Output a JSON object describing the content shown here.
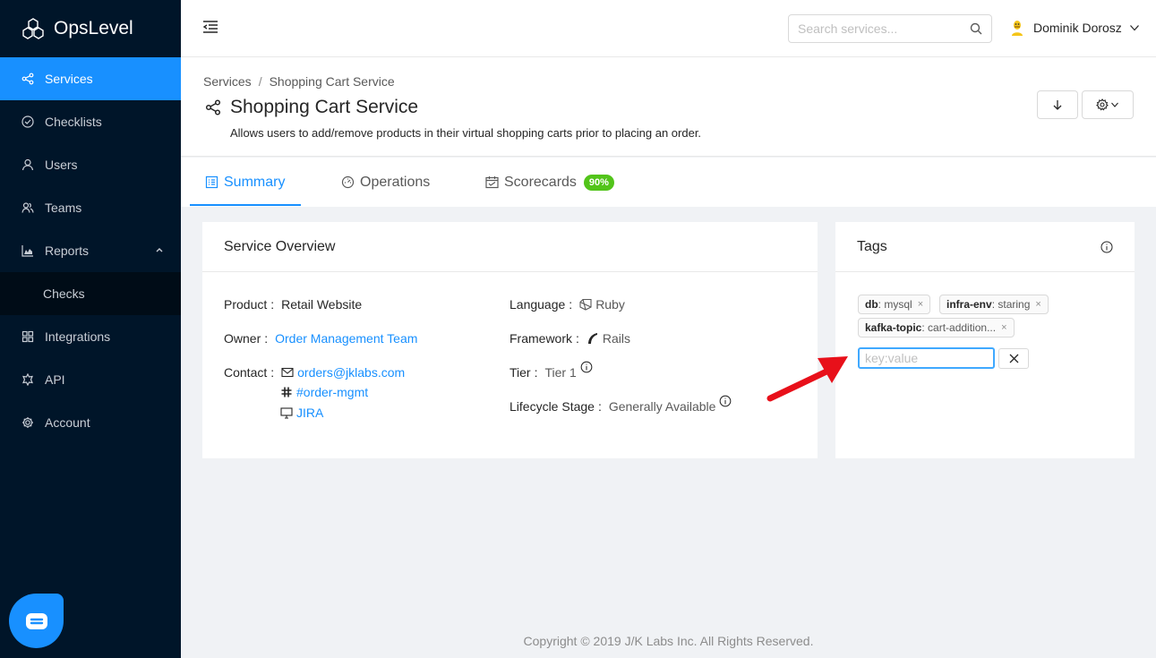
{
  "brand": {
    "name": "OpsLevel"
  },
  "sidebar": {
    "items": [
      {
        "label": "Services",
        "icon": "share-icon"
      },
      {
        "label": "Checklists",
        "icon": "check-circle-icon"
      },
      {
        "label": "Users",
        "icon": "user-icon"
      },
      {
        "label": "Teams",
        "icon": "team-icon"
      },
      {
        "label": "Reports",
        "icon": "area-chart-icon"
      },
      {
        "label": "Checks",
        "icon": ""
      },
      {
        "label": "Integrations",
        "icon": "appstore-icon"
      },
      {
        "label": "API",
        "icon": "api-icon"
      },
      {
        "label": "Account",
        "icon": "setting-icon"
      }
    ],
    "active_color": "#1890ff",
    "background": "#001529"
  },
  "header": {
    "search_placeholder": "Search services...",
    "user_name": "Dominik Dorosz"
  },
  "breadcrumb": {
    "root": "Services",
    "separator": "/",
    "current": "Shopping Cart Service"
  },
  "service": {
    "title": "Shopping Cart Service",
    "description": "Allows users to add/remove products in their virtual shopping carts prior to placing an order."
  },
  "tabs": [
    {
      "label": "Summary",
      "icon": "profile-icon"
    },
    {
      "label": "Operations",
      "icon": "dashboard-icon"
    },
    {
      "label": "Scorecards",
      "icon": "calendar-icon",
      "badge": "90%"
    }
  ],
  "overview": {
    "title": "Service Overview",
    "product_label": "Product",
    "product": "Retail Website",
    "owner_label": "Owner",
    "owner": "Order Management Team",
    "contact_label": "Contact",
    "contacts": [
      "orders@jklabs.com",
      "#order-mgmt",
      "JIRA"
    ],
    "language_label": "Language",
    "language": "Ruby",
    "framework_label": "Framework",
    "framework": "Rails",
    "tier_label": "Tier",
    "tier": "Tier 1",
    "lifecycle_label": "Lifecycle Stage",
    "lifecycle": "Generally Available",
    "colon": ":"
  },
  "tags": {
    "title": "Tags",
    "items": [
      {
        "key": "db",
        "value": "mysql"
      },
      {
        "key": "infra-env",
        "value": "staring"
      },
      {
        "key": "kafka-topic",
        "value": "cart-addition..."
      }
    ],
    "input_placeholder": "key:value",
    "close_mark": "×"
  },
  "footer": {
    "text": "Copyright © 2019 J/K Labs Inc. All Rights Reserved."
  },
  "colors": {
    "link": "#1890ff",
    "badge": "#52c41a",
    "annotation_arrow": "#e8101a"
  }
}
